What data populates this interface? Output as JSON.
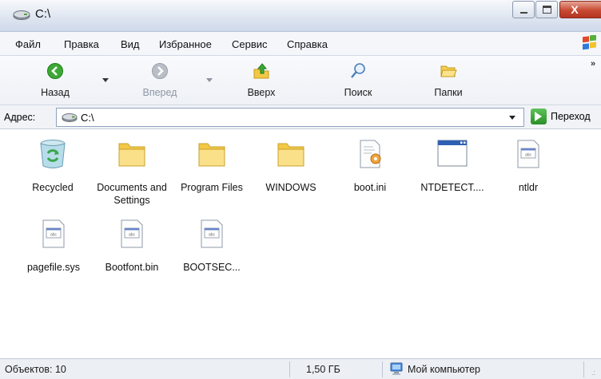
{
  "window": {
    "title": "C:\\",
    "icons": {
      "title": "drive-icon",
      "minimize": "minimize-icon",
      "maximize": "maximize-icon",
      "close": "close-icon"
    },
    "close_glyph": "X"
  },
  "menu": {
    "items": [
      "Файл",
      "Правка",
      "Вид",
      "Избранное",
      "Сервис",
      "Справка"
    ]
  },
  "toolbar": {
    "back": {
      "label": "Назад",
      "icon": "back-arrow-icon"
    },
    "forward": {
      "label": "Вперед",
      "icon": "forward-arrow-icon"
    },
    "up": {
      "label": "Вверх",
      "icon": "folder-up-icon"
    },
    "search": {
      "label": "Поиск",
      "icon": "search-icon"
    },
    "folders": {
      "label": "Папки",
      "icon": "folders-icon"
    },
    "overflow": "»"
  },
  "address": {
    "label": "Адрес:",
    "value": "C:\\",
    "go_label": "Переход"
  },
  "files": [
    {
      "name": "Recycled",
      "icon": "recycle-bin-icon"
    },
    {
      "name": "Documents and Settings",
      "icon": "folder-icon"
    },
    {
      "name": "Program Files",
      "icon": "folder-icon"
    },
    {
      "name": "WINDOWS",
      "icon": "folder-icon"
    },
    {
      "name": "boot.ini",
      "icon": "config-file-icon"
    },
    {
      "name": "NTDETECT....",
      "icon": "application-icon"
    },
    {
      "name": "ntldr",
      "icon": "system-file-icon"
    },
    {
      "name": "pagefile.sys",
      "icon": "system-file-icon"
    },
    {
      "name": "Bootfont.bin",
      "icon": "system-file-icon"
    },
    {
      "name": "BOOTSEC...",
      "icon": "system-file-icon"
    }
  ],
  "status": {
    "objects": "Объектов: 10",
    "size": "1,50 ГБ",
    "location": "Мой компьютер"
  },
  "colors": {
    "folder": "#f7d26a",
    "go_green": "#2b8f27",
    "close_red": "#c84a33"
  }
}
